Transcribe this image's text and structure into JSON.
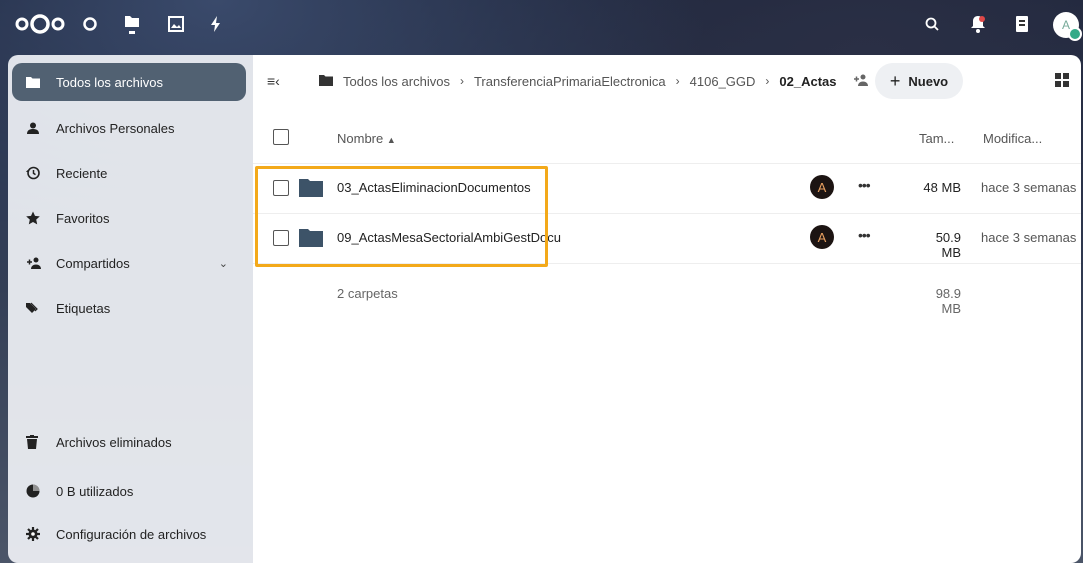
{
  "header": {
    "logo_icon": "nextcloud-logo",
    "apps": [
      "dashboard-icon",
      "files-icon",
      "photos-icon",
      "activity-icon"
    ],
    "right_icons": [
      "search-icon",
      "notifications-icon",
      "contacts-icon"
    ],
    "user_initial": "A"
  },
  "sidebar": {
    "items": [
      {
        "label": "Todos los archivos",
        "icon": "folder-icon"
      },
      {
        "label": "Archivos Personales",
        "icon": "user-icon"
      },
      {
        "label": "Reciente",
        "icon": "history-icon"
      },
      {
        "label": "Favoritos",
        "icon": "star-icon"
      },
      {
        "label": "Compartidos",
        "icon": "share-icon"
      },
      {
        "label": "Etiquetas",
        "icon": "tag-icon"
      }
    ],
    "footer": [
      {
        "label": "Archivos eliminados",
        "icon": "trash-icon"
      },
      {
        "label": "0 B utilizados",
        "icon": "pie-chart-icon"
      },
      {
        "label": "Configuración de archivos",
        "icon": "gear-icon"
      }
    ]
  },
  "breadcrumb": {
    "items": [
      "Todos los archivos",
      "TransferenciaPrimariaElectronica",
      "4106_GGD"
    ],
    "current": "02_Actas"
  },
  "toolbar": {
    "new_label": "Nuevo"
  },
  "table": {
    "headers": {
      "name": "Nombre",
      "size": "Tam...",
      "modified": "Modifica..."
    },
    "rows": [
      {
        "name": "03_ActasEliminacionDocumentos",
        "owner": "A",
        "size": "48 MB",
        "modified": "hace 3 semanas"
      },
      {
        "name": "09_ActasMesaSectorialAmbiGestDocu",
        "owner": "A",
        "size": "50.9 MB",
        "modified": "hace 3 semanas"
      }
    ],
    "summary": {
      "count": "2 carpetas",
      "total": "98.9 MB"
    }
  },
  "colors": {
    "accent": "#516172",
    "highlight": "#f3a91a",
    "folder": "#3d5368"
  }
}
